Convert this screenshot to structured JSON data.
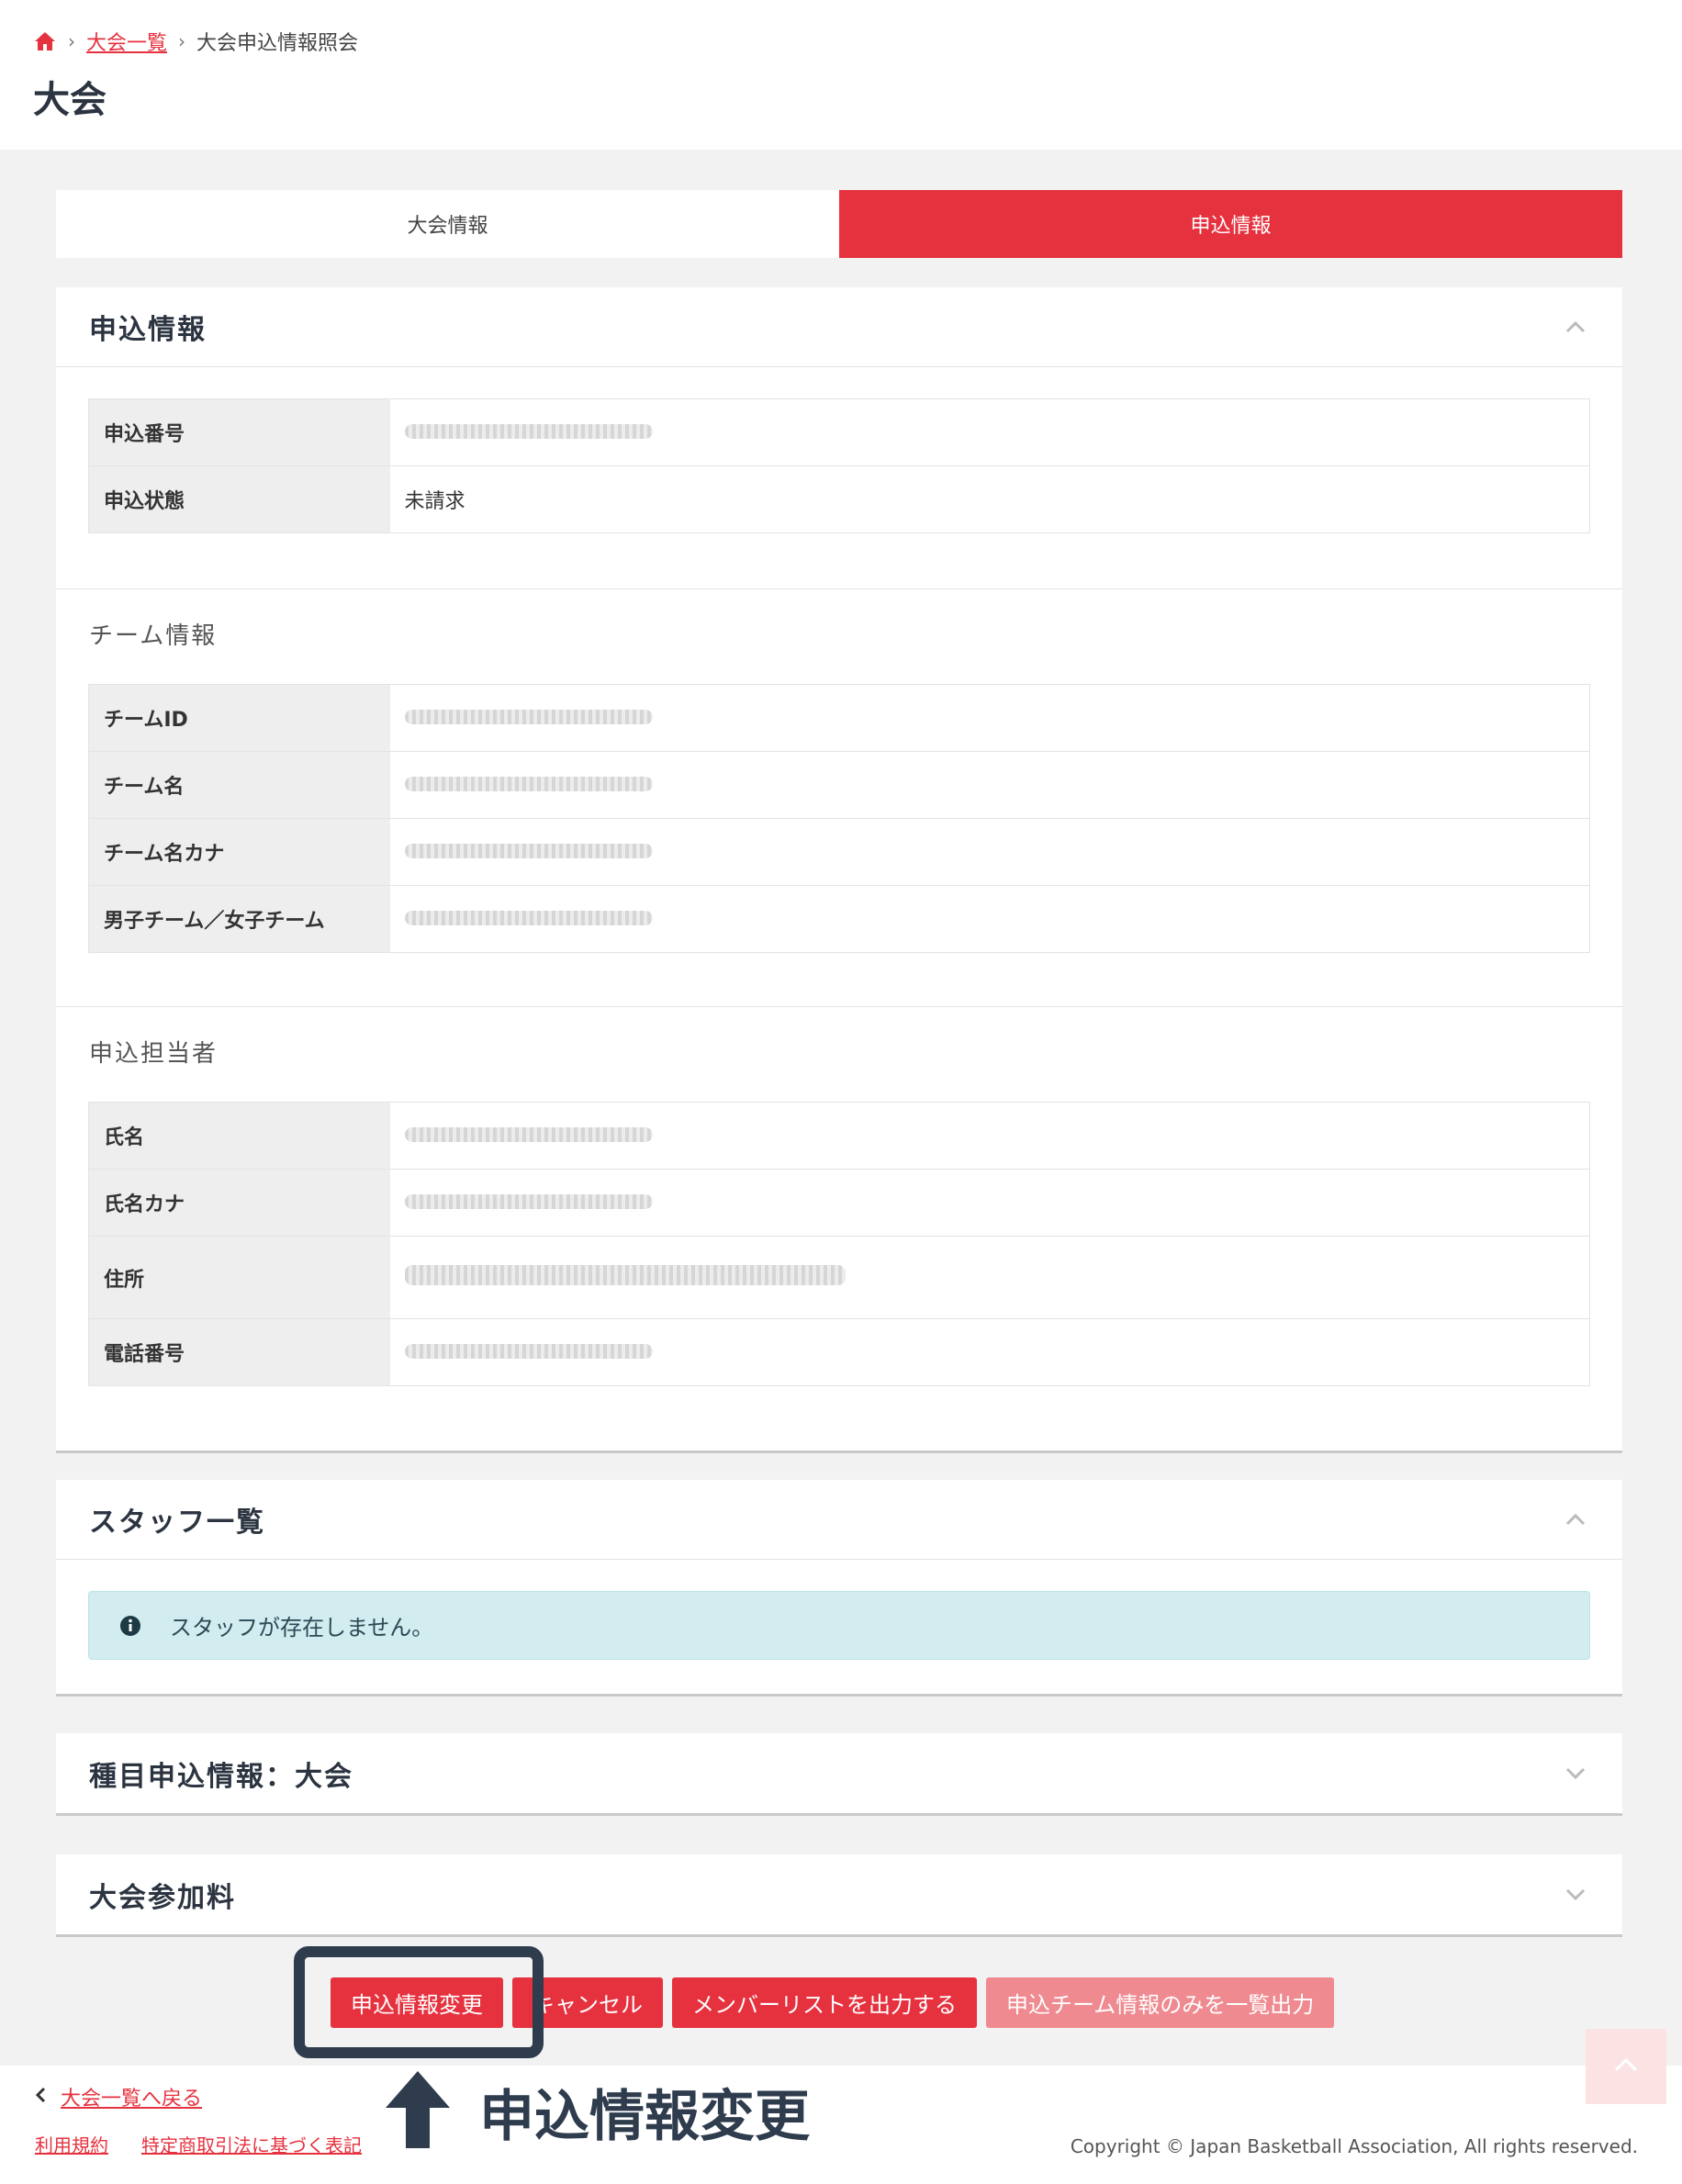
{
  "breadcrumb": {
    "link": "大会一覧",
    "current": "大会申込情報照会"
  },
  "page_title": "大会",
  "tabs": [
    {
      "label": "大会情報",
      "active": false
    },
    {
      "label": "申込情報",
      "active": true
    }
  ],
  "application_card": {
    "title": "申込情報",
    "fields": [
      {
        "label": "申込番号",
        "value": ""
      },
      {
        "label": "申込状態",
        "value": "未請求"
      }
    ],
    "team_section": {
      "title": "チーム情報",
      "fields": [
        {
          "label": "チームID",
          "value": ""
        },
        {
          "label": "チーム名",
          "value": ""
        },
        {
          "label": "チーム名カナ",
          "value": ""
        },
        {
          "label": "男子チーム／女子チーム",
          "value": ""
        }
      ]
    },
    "contact_section": {
      "title": "申込担当者",
      "fields": [
        {
          "label": "氏名",
          "value": ""
        },
        {
          "label": "氏名カナ",
          "value": ""
        },
        {
          "label": "住所",
          "value": ""
        },
        {
          "label": "電話番号",
          "value": ""
        }
      ]
    }
  },
  "staff_card": {
    "title": "スタッフ一覧",
    "alert": "スタッフが存在しません。"
  },
  "event_card": {
    "title": "種目申込情報：大会"
  },
  "fee_card": {
    "title": "大会参加料"
  },
  "actions": {
    "edit": "申込情報変更",
    "cancel": "キャンセル",
    "export_members": "メンバーリストを出力する",
    "export_team": "申込チーム情報のみを一覧出力"
  },
  "footer": {
    "back": "大会一覧へ戻る",
    "terms": "利用規約",
    "tokusho": "特定商取引法に基づく表記",
    "copyright": "Copyright © Japan Basketball Association, All rights reserved."
  },
  "annotation": {
    "label": "申込情報変更"
  },
  "colors": {
    "accent": "#e6323f",
    "dark": "#2f3c4d",
    "alert_bg": "#d2ecf0"
  }
}
